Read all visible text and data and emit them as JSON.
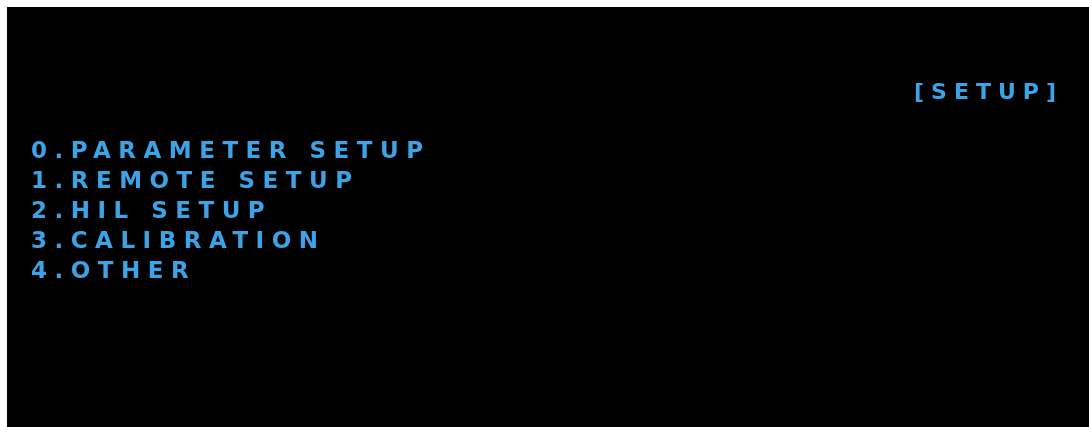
{
  "title": "[SETUP]",
  "menu": [
    {
      "label": "0.PARAMETER SETUP"
    },
    {
      "label": "1.REMOTE SETUP"
    },
    {
      "label": "2.HIL SETUP"
    },
    {
      "label": "3.CALIBRATION"
    },
    {
      "label": "4.OTHER"
    }
  ]
}
